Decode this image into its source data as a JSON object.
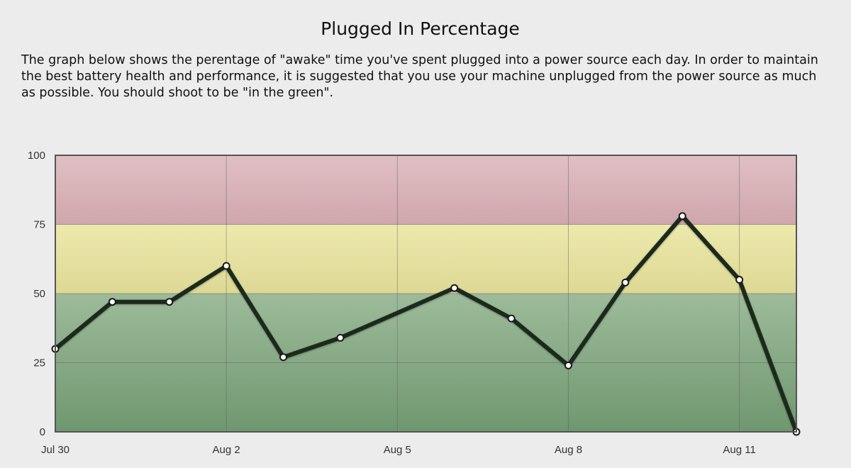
{
  "page": {
    "title": "Plugged In Percentage",
    "description": "The graph below shows the perentage of \"awake\" time you've spent plugged into a power source each day. In order to maintain the best battery health and performance, it is suggested that you use your machine unplugged from the power source as much as possible. You should shoot to be \"in the green\"."
  },
  "chart_data": {
    "type": "line",
    "title": "Plugged In Percentage",
    "xlabel": "",
    "ylabel": "",
    "x_start": "Jul 30",
    "x_tick_labels": [
      "Jul 30",
      "Aug 2",
      "Aug 5",
      "Aug 8",
      "Aug 11"
    ],
    "x": [
      "Jul 30",
      "Jul 31",
      "Aug 1",
      "Aug 2",
      "Aug 3",
      "Aug 4",
      "Aug 5",
      "Aug 6",
      "Aug 7",
      "Aug 8",
      "Aug 9",
      "Aug 10",
      "Aug 11",
      "Aug 12"
    ],
    "values": [
      30,
      47,
      47,
      60,
      27,
      34,
      null,
      52,
      41,
      24,
      54,
      78,
      55,
      0
    ],
    "ylim": [
      0,
      100
    ],
    "y_ticks": [
      0,
      25,
      50,
      75,
      100
    ],
    "grid": true,
    "bands": [
      {
        "from": 0,
        "to": 50,
        "color": "#86ab84"
      },
      {
        "from": 50,
        "to": 75,
        "color": "#e6e3a4"
      },
      {
        "from": 75,
        "to": 100,
        "color": "#d6b0b6"
      }
    ],
    "line_color": "#1e2a1e",
    "marker_color": "#ffffff"
  }
}
